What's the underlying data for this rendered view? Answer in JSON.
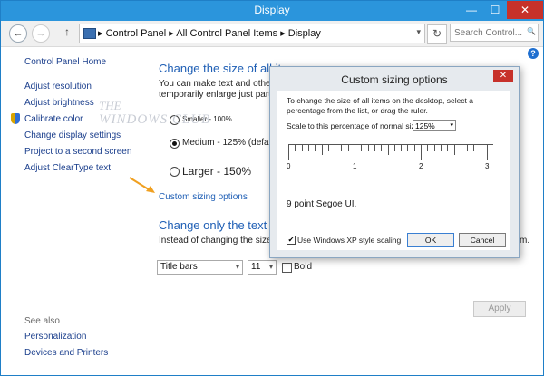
{
  "window": {
    "title": "Display",
    "minimize": "—",
    "maximize": "☐",
    "close": "✕"
  },
  "address": {
    "back": "←",
    "forward": "→",
    "up": "↑",
    "crumbs": "▸  Control Panel  ▸  All Control Panel Items  ▸  Display",
    "dropdown": "▾",
    "refresh": "↻",
    "search_placeholder": "Search Control...",
    "search_icon": "🔍"
  },
  "help": "?",
  "sidebar": {
    "home": "Control Panel Home",
    "items": [
      "Adjust resolution",
      "Adjust brightness",
      "Calibrate color",
      "Change display settings",
      "Project to a second screen",
      "Adjust ClearType text"
    ],
    "see_also": "See also",
    "see_also_items": [
      "Personalization",
      "Devices and Printers"
    ]
  },
  "main": {
    "heading1": "Change the size of all items",
    "desc1": "You can make text and other items",
    "desc2": "temporarily enlarge just part of",
    "options": [
      {
        "label": "Smaller - 100%",
        "selected": false
      },
      {
        "label": "Medium - 125% (default)",
        "selected": true
      },
      {
        "label": "Larger - 150%",
        "selected": false
      }
    ],
    "custom_link": "Custom sizing options",
    "heading2": "Change only the text size",
    "desc3": "Instead of changing the size o",
    "desc3_end": "m.",
    "element_select": "Title bars",
    "size_select": "11",
    "bold_label": "Bold",
    "apply": "Apply"
  },
  "watermark": {
    "line1": "THE",
    "line2": "WINDOWS CLUB"
  },
  "dialog": {
    "title": "Custom sizing options",
    "close": "✕",
    "instr1": "To change the size of all items on the desktop, select a",
    "instr2": "percentage from the list, or drag the ruler.",
    "scale_label": "Scale to this percentage of normal size:",
    "scale_value": "125%",
    "ruler_labels": [
      "0",
      "1",
      "2",
      "3"
    ],
    "font_sample": "9 point Segoe UI.",
    "xp_label": "Use Windows XP style scaling",
    "xp_checked": true,
    "ok": "OK",
    "cancel": "Cancel"
  },
  "colors": {
    "accent": "#2b95dc",
    "link": "#1f5fb5",
    "arrow": "#f0a020"
  }
}
